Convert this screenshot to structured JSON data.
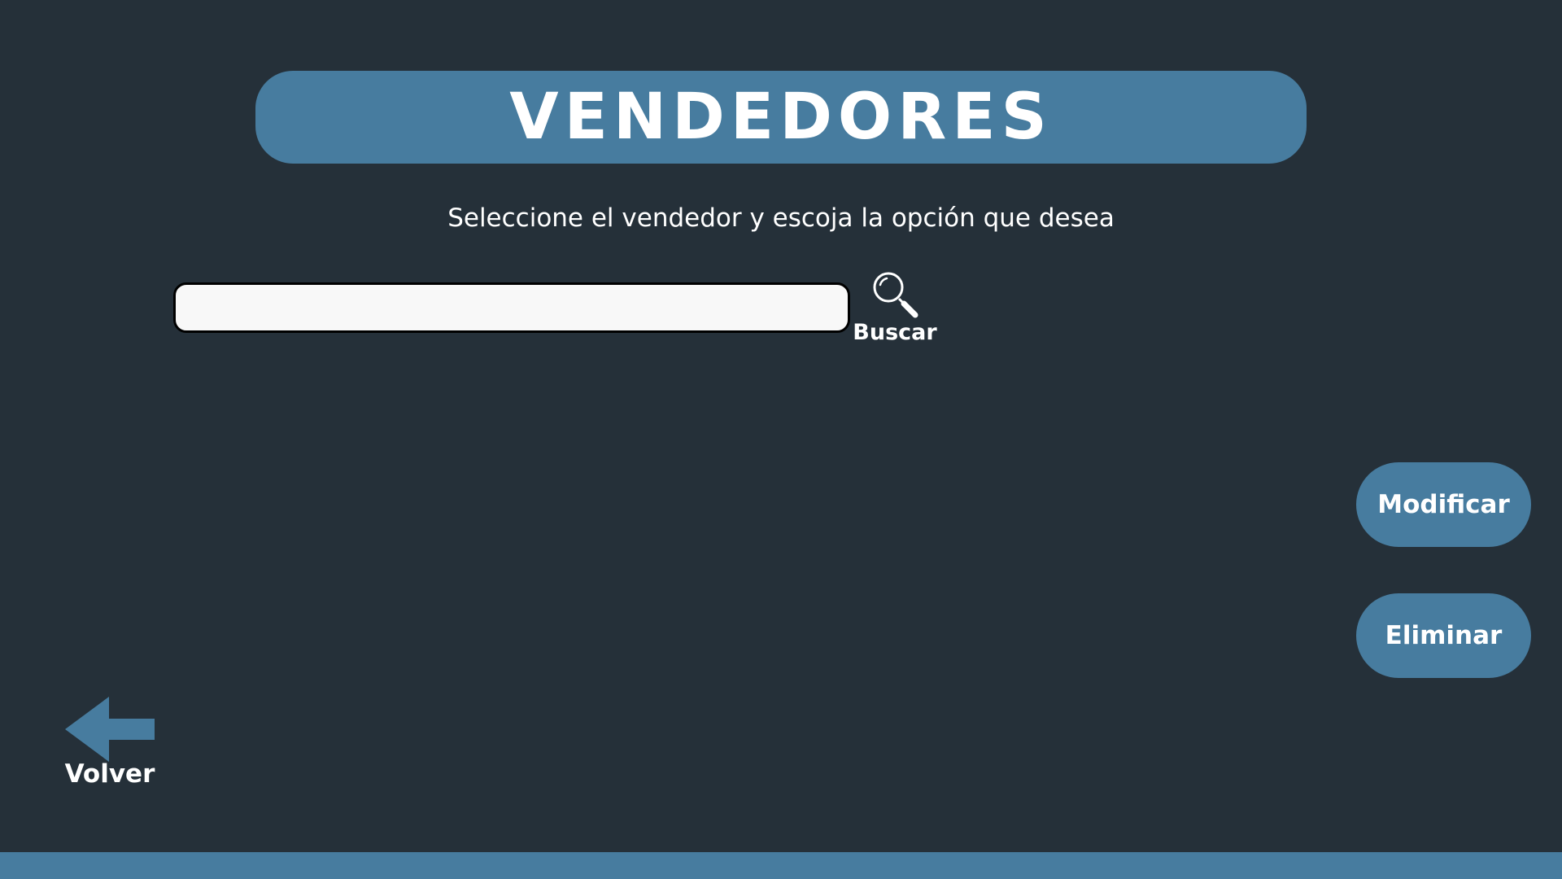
{
  "header": {
    "title": "VENDEDORES"
  },
  "instructions": {
    "text": "Seleccione el vendedor y escoja la opción que desea"
  },
  "search": {
    "value": "",
    "placeholder": "",
    "button_label": "Buscar",
    "icon": "search-icon"
  },
  "actions": {
    "modify_label": "Modificar",
    "delete_label": "Eliminar"
  },
  "navigation": {
    "back_label": "Volver",
    "back_icon": "back-arrow-icon"
  },
  "colors": {
    "background": "#253039",
    "accent": "#477c9f",
    "text": "#ffffff",
    "input_background": "#f8f8f8"
  }
}
